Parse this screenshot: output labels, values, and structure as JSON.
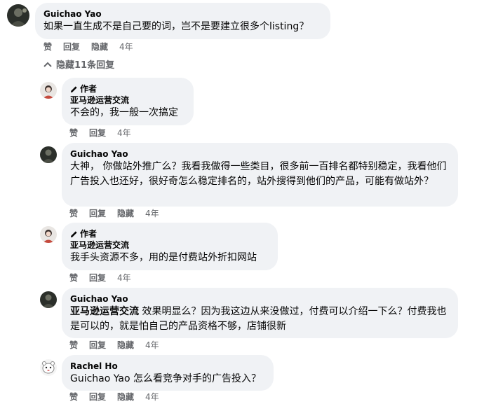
{
  "comments": [
    {
      "name": "Guichao Yao",
      "text": "如果一直生成不是自己要的词，岂不是要建立很多个listing？",
      "actions": {
        "like": "赞",
        "reply": "回复",
        "hide": "隐藏",
        "time": "4年"
      }
    }
  ],
  "toggle": {
    "label": "隐藏11条回复"
  },
  "replies": [
    {
      "author_badge": "作者",
      "name": "亚马逊运营交流",
      "text": "不会的，我一般一次搞定",
      "actions": {
        "like": "赞",
        "reply": "回复",
        "time": "4年"
      }
    },
    {
      "name": "Guichao Yao",
      "text": "大神， 你做站外推广么？我看我做得一些类目，很多前一百排名都特别稳定，我看他们广告投入也还好，很好奇怎么稳定排名的，站外搜得到他们的产品，可能有做站外？",
      "actions": {
        "like": "赞",
        "reply": "回复",
        "hide": "隐藏",
        "time": "4年"
      }
    },
    {
      "author_badge": "作者",
      "name": "亚马逊运营交流",
      "text": "我手头资源不多，用的是付费站外折扣网站",
      "actions": {
        "like": "赞",
        "reply": "回复",
        "time": "4年"
      }
    },
    {
      "name": "Guichao Yao",
      "mention": "亚马逊运营交流",
      "text": " 效果明显么？因为我这边从来没做过，付费可以介绍一下么？付费我也是可以的，就是怕自己的产品资格不够，店铺很新",
      "actions": {
        "like": "赞",
        "reply": "回复",
        "hide": "隐藏",
        "time": "4年"
      }
    },
    {
      "name": "Rachel Ho",
      "text": "Guichao Yao 怎么看竞争对手的广告投入？",
      "actions": {
        "like": "赞",
        "reply": "回复",
        "hide": "隐藏",
        "time": "4年"
      }
    }
  ],
  "colors": {
    "bubble": "#f0f2f5",
    "meta": "#65676b",
    "text": "#050505"
  },
  "icons": {
    "pencil": "pencil-icon",
    "chevron": "chevron-up-icon"
  }
}
